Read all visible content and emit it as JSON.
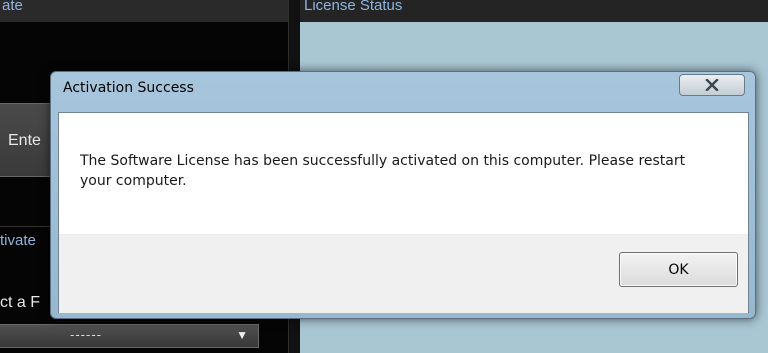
{
  "background": {
    "left_header": "ate",
    "right_header": "License Status",
    "enter_button_label": "Ente",
    "activate_section_label": "tivate",
    "select_label": "ct a F",
    "dropdown_value": "------",
    "dropdown_arrow": "▼"
  },
  "dialog": {
    "title": "Activation Success",
    "close_icon": "close-icon",
    "message": "The Software License has been successfully activated on this computer. Please restart your computer.",
    "ok_label": "OK"
  },
  "colors": {
    "header_text": "#8fb4dd",
    "status_panel": "#a9c6d3",
    "dialog_frame": "#a7c6dd"
  }
}
